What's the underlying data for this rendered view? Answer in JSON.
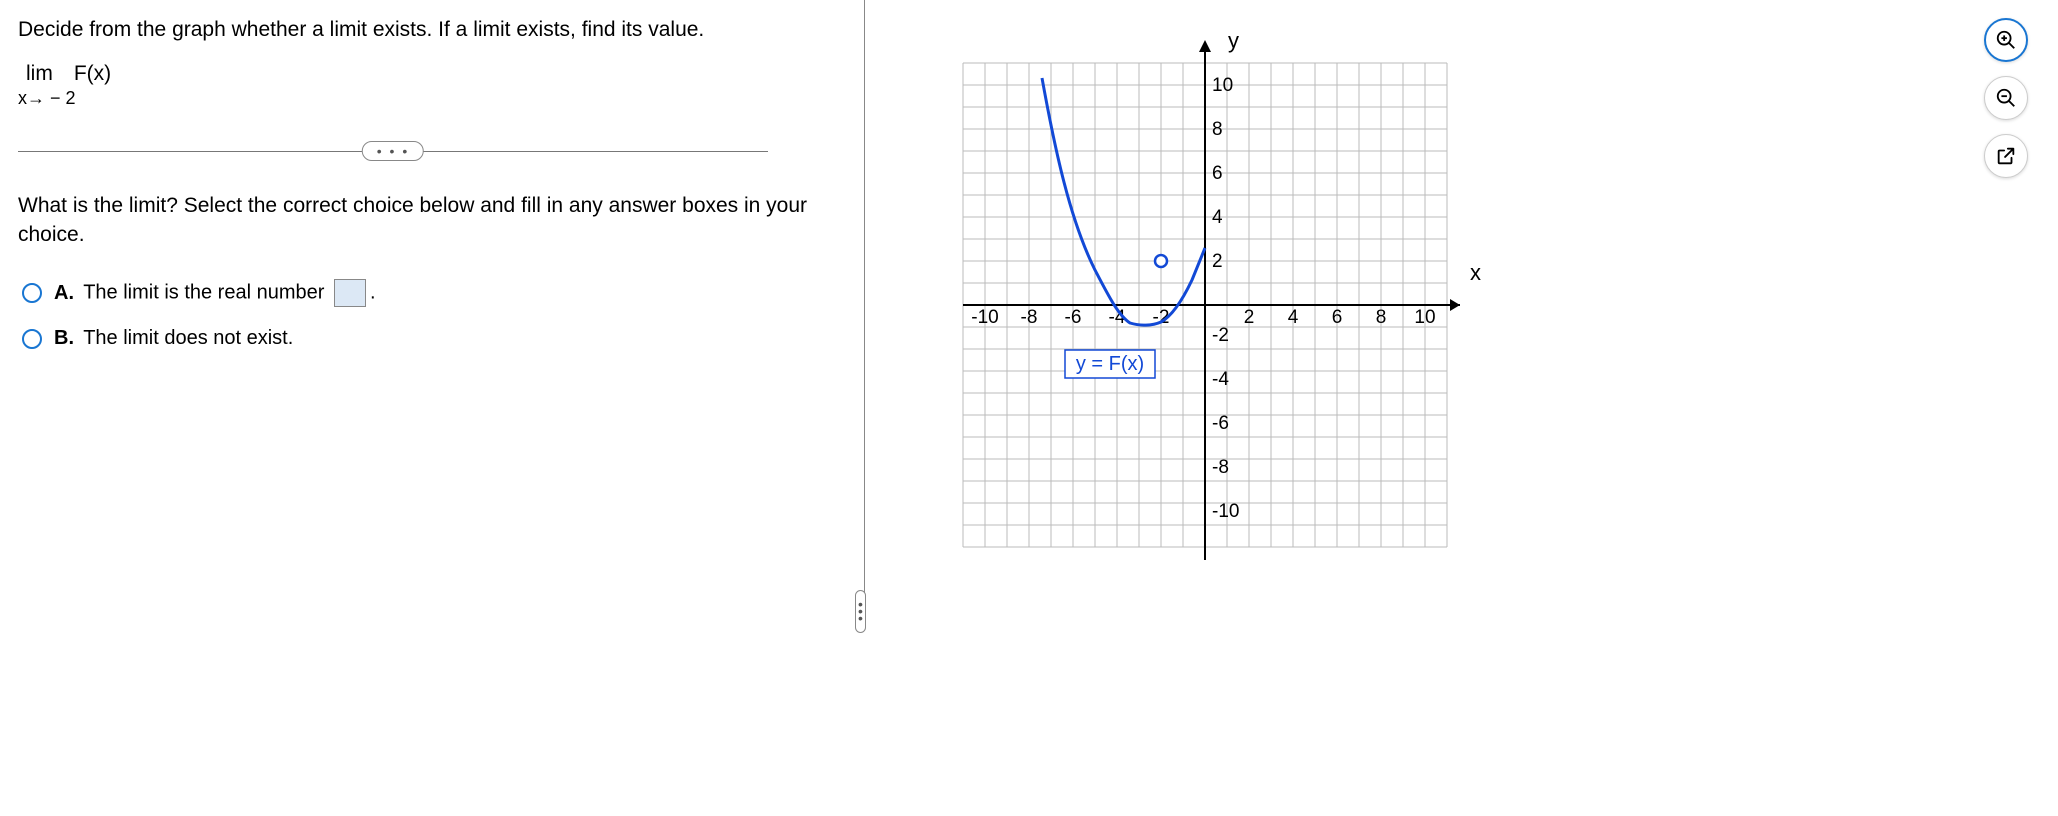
{
  "instruction": "Decide from the graph whether a limit exists. If a limit exists, find its value.",
  "limit_top": "lim F(x)",
  "limit_bottom": "x→ − 2",
  "question": "What is the limit? Select the correct choice below and fill in any answer boxes in your choice.",
  "choices": {
    "A": {
      "letter": "A.",
      "text_before": "The limit is the real number",
      "text_after": "."
    },
    "B": {
      "letter": "B.",
      "text": "The limit does not exist."
    }
  },
  "divider_dots": "• • •",
  "graph": {
    "y_label": "y",
    "x_label": "x",
    "curve_label": "y = F(x)",
    "x_ticks": [
      "-10",
      "-8",
      "-6",
      "-4",
      "-2",
      "2",
      "4",
      "6",
      "8",
      "10"
    ],
    "y_ticks_pos": [
      "10",
      "8",
      "6",
      "4",
      "2"
    ],
    "y_ticks_neg": [
      "-2",
      "-4",
      "-6",
      "-8",
      "-10"
    ]
  },
  "chart_data": {
    "type": "line",
    "title": "",
    "xlabel": "x",
    "ylabel": "y",
    "xlim": [
      -11,
      11
    ],
    "ylim": [
      -11,
      11
    ],
    "grid": true,
    "series": [
      {
        "name": "y = F(x)",
        "x": [
          -7.4,
          -7,
          -6.5,
          -6,
          -5.5,
          -5,
          -4.5,
          -4,
          -3.5,
          -3,
          -2.5,
          -2,
          -1.5,
          -1,
          -0.6
        ],
        "y": [
          10.3,
          8.0,
          5.5,
          3.5,
          2.0,
          0.8,
          0.0,
          -0.5,
          -0.75,
          -0.9,
          -0.9,
          -0.8,
          -0.5,
          0.0,
          1.0
        ]
      }
    ],
    "annotations": [
      {
        "type": "open_point",
        "x": -2,
        "y": 2,
        "note": "open circle at (-2, 2)"
      }
    ],
    "legend": {
      "position": "inside-bottom-left",
      "entries": [
        "y = F(x)"
      ]
    }
  }
}
